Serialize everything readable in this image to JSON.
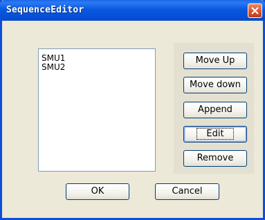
{
  "window": {
    "title": "SequenceEditor"
  },
  "sequence_list": {
    "items": [
      "SMU1",
      "SMU2"
    ]
  },
  "side_buttons": {
    "move_up": "Move Up",
    "move_down": "Move down",
    "append": "Append",
    "edit": "Edit",
    "remove": "Remove"
  },
  "footer_buttons": {
    "ok": "OK",
    "cancel": "Cancel"
  },
  "icons": {
    "close": "close-icon"
  },
  "colors": {
    "titlebar": "#0550d9",
    "dialog_bg": "#ece9d8",
    "close_button": "#d8542e"
  }
}
